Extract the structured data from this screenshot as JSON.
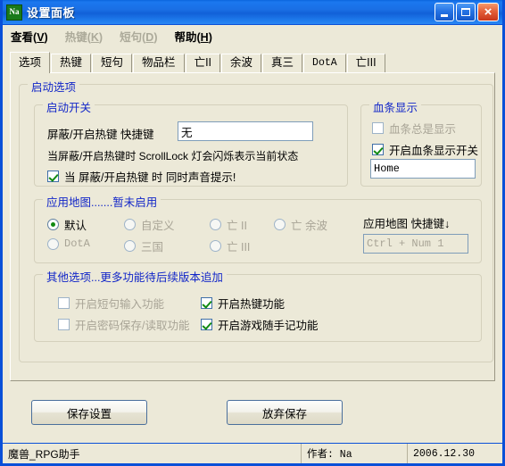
{
  "window": {
    "title": "设置面板",
    "icon_label": "Na",
    "icon_name": "app-icon-na",
    "buttons": {
      "minimize": "minimize-icon",
      "maximize": "maximize-icon",
      "close": "×"
    }
  },
  "menubar": {
    "items": [
      {
        "label": "查看",
        "mnemonic": "V",
        "enabled": true
      },
      {
        "label": "热键",
        "mnemonic": "K",
        "enabled": false
      },
      {
        "label": "短句",
        "mnemonic": "D",
        "enabled": false
      },
      {
        "label": "帮助",
        "mnemonic": "H",
        "enabled": true
      }
    ]
  },
  "tabs": [
    {
      "label": "选项",
      "active": true,
      "mono": false
    },
    {
      "label": "热键",
      "active": false,
      "mono": false
    },
    {
      "label": "短句",
      "active": false,
      "mono": false
    },
    {
      "label": "物品栏",
      "active": false,
      "mono": false
    },
    {
      "label": "亡II",
      "active": false,
      "mono": false
    },
    {
      "label": "余波",
      "active": false,
      "mono": false
    },
    {
      "label": "真三",
      "active": false,
      "mono": false
    },
    {
      "label": "DotA",
      "active": false,
      "mono": true
    },
    {
      "label": "亡III",
      "active": false,
      "mono": false
    }
  ],
  "startup_options": {
    "title": "启动选项",
    "startup_switch": {
      "title": "启动开关",
      "hotkey_label": "屏蔽/开启热键 快捷键",
      "hotkey_value": "无",
      "hint": "当屏蔽/开启热键时 ScrollLock 灯会闪烁表示当前状态",
      "sound_checkbox": {
        "label": "当 屏蔽/开启热键 时 同时声音提示!",
        "checked": true,
        "enabled": true
      }
    },
    "blood_bar": {
      "title": "血条显示",
      "always_show": {
        "label": "血条总是显示",
        "checked": false,
        "enabled": false
      },
      "enable_switch": {
        "label": "开启血条显示开关",
        "checked": true,
        "enabled": true
      },
      "hotkey_value": "Home"
    },
    "apply_map": {
      "title": "应用地图.......暂未启用",
      "hotkey_label": "应用地图 快捷键↓",
      "hotkey_value": "Ctrl + Num 1",
      "hotkey_enabled": false,
      "options": [
        {
          "label": "默认",
          "selected": true,
          "enabled": true,
          "mono": false
        },
        {
          "label": "自定义",
          "selected": false,
          "enabled": false,
          "mono": false
        },
        {
          "label": "亡 II",
          "selected": false,
          "enabled": false,
          "mono": false
        },
        {
          "label": "亡 余波",
          "selected": false,
          "enabled": false,
          "mono": false
        },
        {
          "label": "DotA",
          "selected": false,
          "enabled": false,
          "mono": true
        },
        {
          "label": "三国",
          "selected": false,
          "enabled": false,
          "mono": false
        },
        {
          "label": "亡 III",
          "selected": false,
          "enabled": false,
          "mono": false
        }
      ]
    },
    "other_options": {
      "title": "其他选项...更多功能待后续版本追加",
      "items": [
        {
          "label": "开启短句输入功能",
          "checked": false,
          "enabled": false
        },
        {
          "label": "开启热键功能",
          "checked": true,
          "enabled": true
        },
        {
          "label": "开启密码保存/读取功能",
          "checked": false,
          "enabled": false
        },
        {
          "label": "开启游戏随手记功能",
          "checked": true,
          "enabled": true
        }
      ]
    }
  },
  "footer": {
    "save_button": "保存设置",
    "cancel_button": "放弃保存"
  },
  "statusbar": {
    "app_name": "魔兽_RPG助手",
    "author": "作者: Na",
    "date": "2006.12.30"
  }
}
